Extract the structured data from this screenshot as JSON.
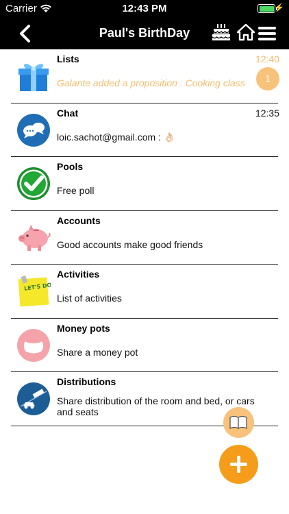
{
  "status_bar": {
    "carrier": "Carrier",
    "time": "12:43 PM"
  },
  "nav": {
    "title": "Paul's BirthDay"
  },
  "rows": [
    {
      "title": "Lists",
      "subtitle": "Galante added a proposition : Cooking class",
      "time": "12:40",
      "badge": "1"
    },
    {
      "title": "Chat",
      "subtitle": "loic.sachot@gmail.com : 👌🏻",
      "time": "12:35"
    },
    {
      "title": "Pools",
      "subtitle": "Free poll"
    },
    {
      "title": "Accounts",
      "subtitle": "Good accounts make good friends"
    },
    {
      "title": "Activities",
      "subtitle": "List of activities",
      "sticker_text": "LET'S DO IT!"
    },
    {
      "title": "Money pots",
      "subtitle": "Share a money pot"
    },
    {
      "title": "Distributions",
      "subtitle": "Share distribution of the room and bed, or cars and seats"
    }
  ],
  "colors": {
    "accent": "#f5bd6e",
    "fab": "#f59d1a",
    "fab_secondary": "#f8c27c",
    "bar": "#000000"
  },
  "icons": [
    "back-icon",
    "birthday-cake-icon",
    "home-icon",
    "menu-icon",
    "gift-icon",
    "chat-bubbles-icon",
    "checkmark-icon",
    "piggy-bank-icon",
    "sticky-note-icon",
    "money-pot-icon",
    "car-bed-icon",
    "book-icon",
    "plus-icon"
  ]
}
